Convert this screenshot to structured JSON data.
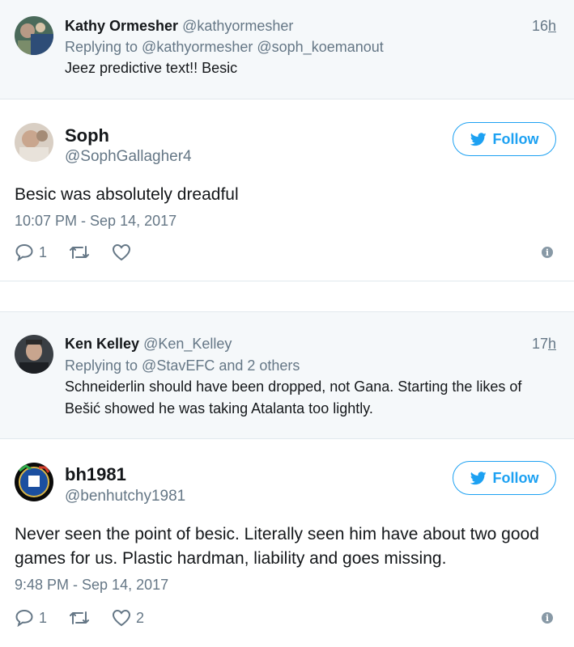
{
  "tweets": [
    {
      "type": "reply",
      "name": "Kathy Ormesher",
      "handle": "@kathyormesher",
      "replying": "Replying to @kathyormesher @soph_koemanout",
      "text": "Jeez predictive text!! Besic",
      "time_num": "16",
      "time_unit": "h"
    },
    {
      "type": "main",
      "name": "Soph",
      "handle": "@SophGallagher4",
      "follow_label": "Follow",
      "text": "Besic was absolutely dreadful",
      "timestamp": "10:07 PM - Sep 14, 2017",
      "reply_count": "1",
      "like_count": ""
    },
    {
      "type": "reply",
      "name": "Ken Kelley",
      "handle": "@Ken_Kelley",
      "replying": "Replying to @StavEFC and 2 others",
      "text": "Schneiderlin should have been dropped, not Gana. Starting the likes of Bešić showed he was taking Atalanta too lightly.",
      "time_num": "17",
      "time_unit": "h"
    },
    {
      "type": "main",
      "name": "bh1981",
      "handle": "@benhutchy1981",
      "follow_label": "Follow",
      "text": "Never seen the point of besic. Literally seen him have about two good games for us. Plastic hardman, liability and goes missing.",
      "timestamp": "9:48 PM - Sep 14, 2017",
      "reply_count": "1",
      "like_count": "2"
    }
  ],
  "colors": {
    "accent": "#1da1f2",
    "muted": "#657786",
    "reply_bg": "#f5f8fa"
  },
  "icons": {
    "bird": "twitter-bird-icon",
    "reply": "reply-icon",
    "retweet": "retweet-icon",
    "like": "heart-icon",
    "info": "info-icon"
  }
}
